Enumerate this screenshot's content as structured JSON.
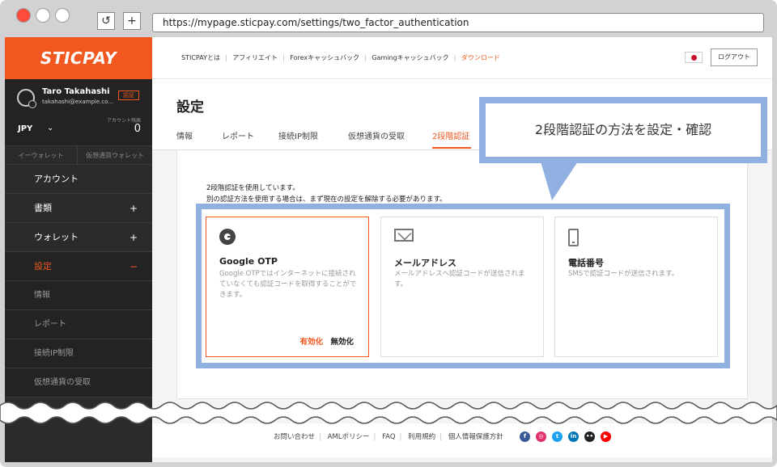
{
  "browser": {
    "url": "https://mypage.sticpay.com/settings/two_factor_authentication",
    "reload_symbol": "↺",
    "new_tab_symbol": "+"
  },
  "sidebar": {
    "logo": "STICPAY",
    "user": {
      "name": "Taro Takahashi",
      "email": "takahashi@example.co...",
      "badge": "認証",
      "balance_label": "アカウント残高",
      "currency": "JPY",
      "balance": "0"
    },
    "wallet_tabs": [
      "イーウォレット",
      "仮想通貨ウォレット"
    ],
    "menu": [
      {
        "label": "アカウント",
        "symbol": ""
      },
      {
        "label": "書類",
        "symbol": "+"
      },
      {
        "label": "ウォレット",
        "symbol": "+"
      },
      {
        "label": "設定",
        "symbol": "−"
      },
      {
        "label": "情報",
        "symbol": ""
      },
      {
        "label": "レポート",
        "symbol": ""
      },
      {
        "label": "接続IP制限",
        "symbol": ""
      },
      {
        "label": "仮想通貨の受取",
        "symbol": ""
      }
    ]
  },
  "topbar": {
    "nav": [
      "STICPAYとは",
      "アフィリエイト",
      "Forexキャッシュバック",
      "Gamingキャッシュバック",
      "ダウンロード"
    ],
    "logout": "ログアウト"
  },
  "content": {
    "title": "設定",
    "tabs": [
      "情報",
      "レポート",
      "接続IP制限",
      "仮想通貨の受取",
      "2段階認証"
    ],
    "info_line1": "2段階認証を使用しています。",
    "info_line2": "別の認証方法を使用する場合は、まず現在の設定を解除する必要があります。",
    "cards": [
      {
        "icon": "google-authenticator-icon",
        "title": "Google OTP",
        "desc": "Google OTPではインターネットに接続されていなくても認証コードを取得することができます。",
        "enable": "有効化",
        "disable": "無効化"
      },
      {
        "icon": "mail-icon",
        "title": "メールアドレス",
        "desc": "メールアドレスへ認証コードが送信されます。"
      },
      {
        "icon": "phone-icon",
        "title": "電話番号",
        "desc": "SMSで認証コードが送信されます。"
      }
    ]
  },
  "callout": {
    "text": "2段階認証の方法を設定・確認",
    "color": "#8fb0e0"
  },
  "footer": {
    "links": [
      "お問い合わせ",
      "AMLポリシー",
      "FAQ",
      "利用規約",
      "個人情報保護方針"
    ],
    "social": [
      {
        "name": "facebook-icon",
        "color": "#3b5998",
        "glyph": "f"
      },
      {
        "name": "instagram-icon",
        "color": "#e1306c",
        "glyph": "◎"
      },
      {
        "name": "twitter-icon",
        "color": "#1da1f2",
        "glyph": "t"
      },
      {
        "name": "linkedin-icon",
        "color": "#0077b5",
        "glyph": "in"
      },
      {
        "name": "flickr-icon",
        "color": "#222222",
        "glyph": "••"
      },
      {
        "name": "youtube-icon",
        "color": "#ff0000",
        "glyph": "▶"
      }
    ]
  },
  "colors": {
    "brand": "#f0581f",
    "sidebar": "#2b2b2b",
    "highlight": "#8fb0e0"
  }
}
